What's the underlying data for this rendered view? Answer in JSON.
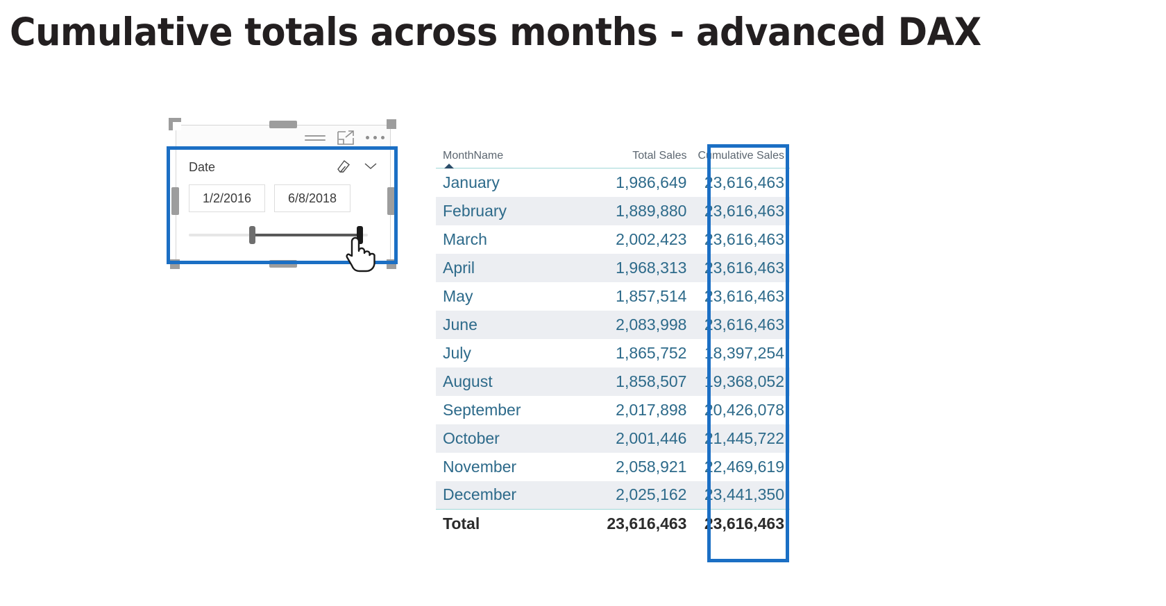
{
  "page": {
    "title": "Cumulative totals across months - advanced DAX",
    "accent_blue": "#1b6fc4",
    "table_text_color": "#2d6a8a",
    "header_rule_color": "#9fd7d7"
  },
  "slicer": {
    "field_label": "Date",
    "start_date": "1/2/2016",
    "end_date": "6/8/2018",
    "icons": {
      "filter": "filter-icon",
      "focus": "focus-mode-icon",
      "more": "more-options-icon",
      "clear": "eraser-clear-filter-icon",
      "expand": "chevron-down-icon"
    },
    "slider": {
      "left_handle_pct": 34,
      "right_handle_pct": 94
    }
  },
  "table": {
    "columns": [
      "MonthName",
      "Total Sales",
      "Cumulative Sales"
    ],
    "sort_column": "MonthName",
    "sort_direction": "ascending",
    "rows": [
      {
        "month": "January",
        "total_sales": "1,986,649",
        "cumulative_sales": "23,616,463"
      },
      {
        "month": "February",
        "total_sales": "1,889,880",
        "cumulative_sales": "23,616,463"
      },
      {
        "month": "March",
        "total_sales": "2,002,423",
        "cumulative_sales": "23,616,463"
      },
      {
        "month": "April",
        "total_sales": "1,968,313",
        "cumulative_sales": "23,616,463"
      },
      {
        "month": "May",
        "total_sales": "1,857,514",
        "cumulative_sales": "23,616,463"
      },
      {
        "month": "June",
        "total_sales": "2,083,998",
        "cumulative_sales": "23,616,463"
      },
      {
        "month": "July",
        "total_sales": "1,865,752",
        "cumulative_sales": "18,397,254"
      },
      {
        "month": "August",
        "total_sales": "1,858,507",
        "cumulative_sales": "19,368,052"
      },
      {
        "month": "September",
        "total_sales": "2,017,898",
        "cumulative_sales": "20,426,078"
      },
      {
        "month": "October",
        "total_sales": "2,001,446",
        "cumulative_sales": "21,445,722"
      },
      {
        "month": "November",
        "total_sales": "2,058,921",
        "cumulative_sales": "22,469,619"
      },
      {
        "month": "December",
        "total_sales": "2,025,162",
        "cumulative_sales": "23,441,350"
      }
    ],
    "total_row": {
      "month": "Total",
      "total_sales": "23,616,463",
      "cumulative_sales": "23,616,463"
    }
  },
  "chart_data": {
    "type": "table",
    "title": "Cumulative totals across months - advanced DAX",
    "columns": [
      "MonthName",
      "Total Sales",
      "Cumulative Sales"
    ],
    "categories": [
      "January",
      "February",
      "March",
      "April",
      "May",
      "June",
      "July",
      "August",
      "September",
      "October",
      "November",
      "December"
    ],
    "series": [
      {
        "name": "Total Sales",
        "values": [
          1986649,
          1889880,
          2002423,
          1968313,
          1857514,
          2083998,
          1865752,
          1858507,
          2017898,
          2001446,
          2058921,
          2025162
        ]
      },
      {
        "name": "Cumulative Sales",
        "values": [
          23616463,
          23616463,
          23616463,
          23616463,
          23616463,
          23616463,
          18397254,
          19368052,
          20426078,
          21445722,
          22469619,
          23441350
        ]
      }
    ],
    "totals": {
      "Total Sales": 23616463,
      "Cumulative Sales": 23616463
    }
  }
}
